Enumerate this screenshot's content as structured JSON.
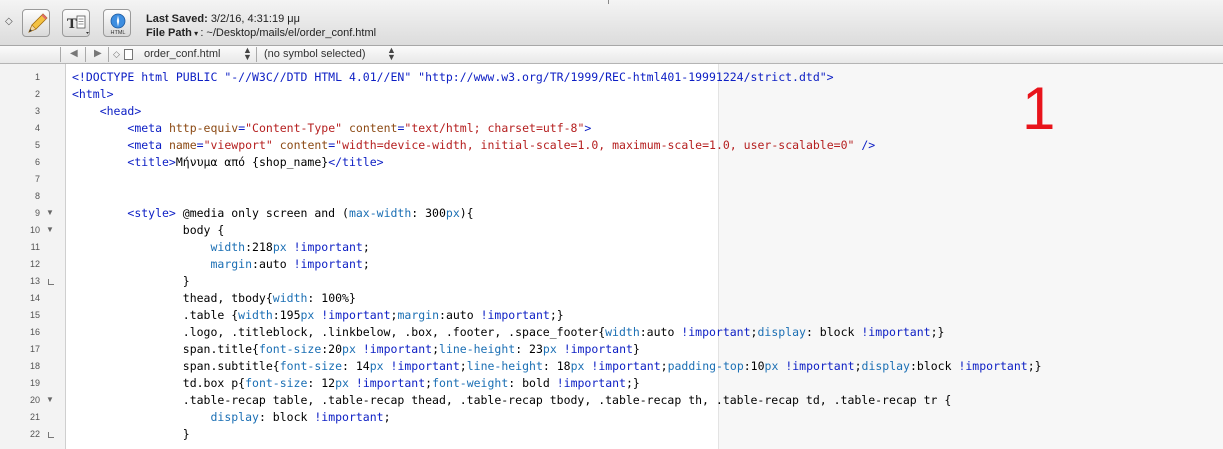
{
  "toolbar": {
    "last_saved_label": "Last Saved:",
    "last_saved_value": "3/2/16, 4:31:19 μμ",
    "file_path_label": "File Path",
    "file_path_value": ": ~/Desktop/mails/el/order_conf.html",
    "html_button_label": "HTML"
  },
  "navbar": {
    "file_name": "order_conf.html",
    "symbol": "(no symbol selected)"
  },
  "annotation": "1",
  "editor": {
    "line_numbers": [
      "1",
      "2",
      "3",
      "4",
      "5",
      "6",
      "7",
      "8",
      "9",
      "10",
      "11",
      "12",
      "13",
      "14",
      "15",
      "16",
      "17",
      "18",
      "19",
      "20",
      "21",
      "22"
    ],
    "lines": [
      [
        {
          "t": "<!DOCTYPE html PUBLIC \"-//W3C//DTD HTML 4.01//EN\" \"http://www.w3.org/TR/1999/REC-html401-19991224/strict.dtd\">",
          "c": "k"
        }
      ],
      [
        {
          "t": "<html>",
          "c": "k"
        }
      ],
      [
        {
          "t": "    "
        },
        {
          "t": "<head>",
          "c": "k"
        }
      ],
      [
        {
          "t": "        "
        },
        {
          "t": "<meta ",
          "c": "k"
        },
        {
          "t": "http-equiv",
          "c": "a"
        },
        {
          "t": "=",
          "c": "k"
        },
        {
          "t": "\"Content-Type\"",
          "c": "s"
        },
        {
          "t": " content",
          "c": "a"
        },
        {
          "t": "=",
          "c": "k"
        },
        {
          "t": "\"text/html; charset=utf-8\"",
          "c": "s"
        },
        {
          "t": ">",
          "c": "k"
        }
      ],
      [
        {
          "t": "        "
        },
        {
          "t": "<meta ",
          "c": "k"
        },
        {
          "t": "name",
          "c": "a"
        },
        {
          "t": "=",
          "c": "k"
        },
        {
          "t": "\"viewport\"",
          "c": "s"
        },
        {
          "t": " content",
          "c": "a"
        },
        {
          "t": "=",
          "c": "k"
        },
        {
          "t": "\"width=device-width, initial-scale=1.0, maximum-scale=1.0, user-scalable=0\"",
          "c": "s"
        },
        {
          "t": " />",
          "c": "k"
        }
      ],
      [
        {
          "t": "        "
        },
        {
          "t": "<title>",
          "c": "k"
        },
        {
          "t": "Μήνυμα από {shop_name}"
        },
        {
          "t": "</title>",
          "c": "k"
        }
      ],
      [
        {
          "t": ""
        }
      ],
      [
        {
          "t": ""
        }
      ],
      [
        {
          "t": "        "
        },
        {
          "t": "<style>",
          "c": "k"
        },
        {
          "t": " @media only screen and ("
        },
        {
          "t": "max-width",
          "c": "c"
        },
        {
          "t": ": 300"
        },
        {
          "t": "px",
          "c": "c"
        },
        {
          "t": "){"
        }
      ],
      [
        {
          "t": "                body {"
        }
      ],
      [
        {
          "t": "                    "
        },
        {
          "t": "width",
          "c": "c"
        },
        {
          "t": ":218"
        },
        {
          "t": "px",
          "c": "c"
        },
        {
          "t": " "
        },
        {
          "t": "!important",
          "c": "k"
        },
        {
          "t": ";"
        }
      ],
      [
        {
          "t": "                    "
        },
        {
          "t": "margin",
          "c": "c"
        },
        {
          "t": ":auto "
        },
        {
          "t": "!important",
          "c": "k"
        },
        {
          "t": ";"
        }
      ],
      [
        {
          "t": "                }"
        }
      ],
      [
        {
          "t": "                thead, tbody{"
        },
        {
          "t": "width",
          "c": "c"
        },
        {
          "t": ": 100%}"
        }
      ],
      [
        {
          "t": "                .table {"
        },
        {
          "t": "width",
          "c": "c"
        },
        {
          "t": ":195"
        },
        {
          "t": "px",
          "c": "c"
        },
        {
          "t": " "
        },
        {
          "t": "!important",
          "c": "k"
        },
        {
          "t": ";"
        },
        {
          "t": "margin",
          "c": "c"
        },
        {
          "t": ":auto "
        },
        {
          "t": "!important",
          "c": "k"
        },
        {
          "t": ";}"
        }
      ],
      [
        {
          "t": "                .logo, .titleblock, .linkbelow, .box, .footer, .space_footer{"
        },
        {
          "t": "width",
          "c": "c"
        },
        {
          "t": ":auto "
        },
        {
          "t": "!important",
          "c": "k"
        },
        {
          "t": ";"
        },
        {
          "t": "display",
          "c": "c"
        },
        {
          "t": ": block "
        },
        {
          "t": "!important",
          "c": "k"
        },
        {
          "t": ";}"
        }
      ],
      [
        {
          "t": "                span.title{"
        },
        {
          "t": "font-size",
          "c": "c"
        },
        {
          "t": ":20"
        },
        {
          "t": "px",
          "c": "c"
        },
        {
          "t": " "
        },
        {
          "t": "!important",
          "c": "k"
        },
        {
          "t": ";"
        },
        {
          "t": "line-height",
          "c": "c"
        },
        {
          "t": ": 23"
        },
        {
          "t": "px",
          "c": "c"
        },
        {
          "t": " "
        },
        {
          "t": "!important",
          "c": "k"
        },
        {
          "t": "}"
        }
      ],
      [
        {
          "t": "                span.subtitle{"
        },
        {
          "t": "font-size",
          "c": "c"
        },
        {
          "t": ": 14"
        },
        {
          "t": "px",
          "c": "c"
        },
        {
          "t": " "
        },
        {
          "t": "!important",
          "c": "k"
        },
        {
          "t": ";"
        },
        {
          "t": "line-height",
          "c": "c"
        },
        {
          "t": ": 18"
        },
        {
          "t": "px",
          "c": "c"
        },
        {
          "t": " "
        },
        {
          "t": "!important",
          "c": "k"
        },
        {
          "t": ";"
        },
        {
          "t": "padding-top",
          "c": "c"
        },
        {
          "t": ":10"
        },
        {
          "t": "px",
          "c": "c"
        },
        {
          "t": " "
        },
        {
          "t": "!important",
          "c": "k"
        },
        {
          "t": ";"
        },
        {
          "t": "display",
          "c": "c"
        },
        {
          "t": ":block "
        },
        {
          "t": "!important",
          "c": "k"
        },
        {
          "t": ";}"
        }
      ],
      [
        {
          "t": "                td.box p{"
        },
        {
          "t": "font-size",
          "c": "c"
        },
        {
          "t": ": 12"
        },
        {
          "t": "px",
          "c": "c"
        },
        {
          "t": " "
        },
        {
          "t": "!important",
          "c": "k"
        },
        {
          "t": ";"
        },
        {
          "t": "font-weight",
          "c": "c"
        },
        {
          "t": ": bold "
        },
        {
          "t": "!important",
          "c": "k"
        },
        {
          "t": ";}"
        }
      ],
      [
        {
          "t": "                .table-recap table, .table-recap thead, .table-recap tbody, .table-recap th, .table-recap td, .table-recap tr {"
        }
      ],
      [
        {
          "t": "                    "
        },
        {
          "t": "display",
          "c": "c"
        },
        {
          "t": ": block "
        },
        {
          "t": "!important",
          "c": "k"
        },
        {
          "t": ";"
        }
      ],
      [
        {
          "t": "                }"
        }
      ]
    ]
  }
}
